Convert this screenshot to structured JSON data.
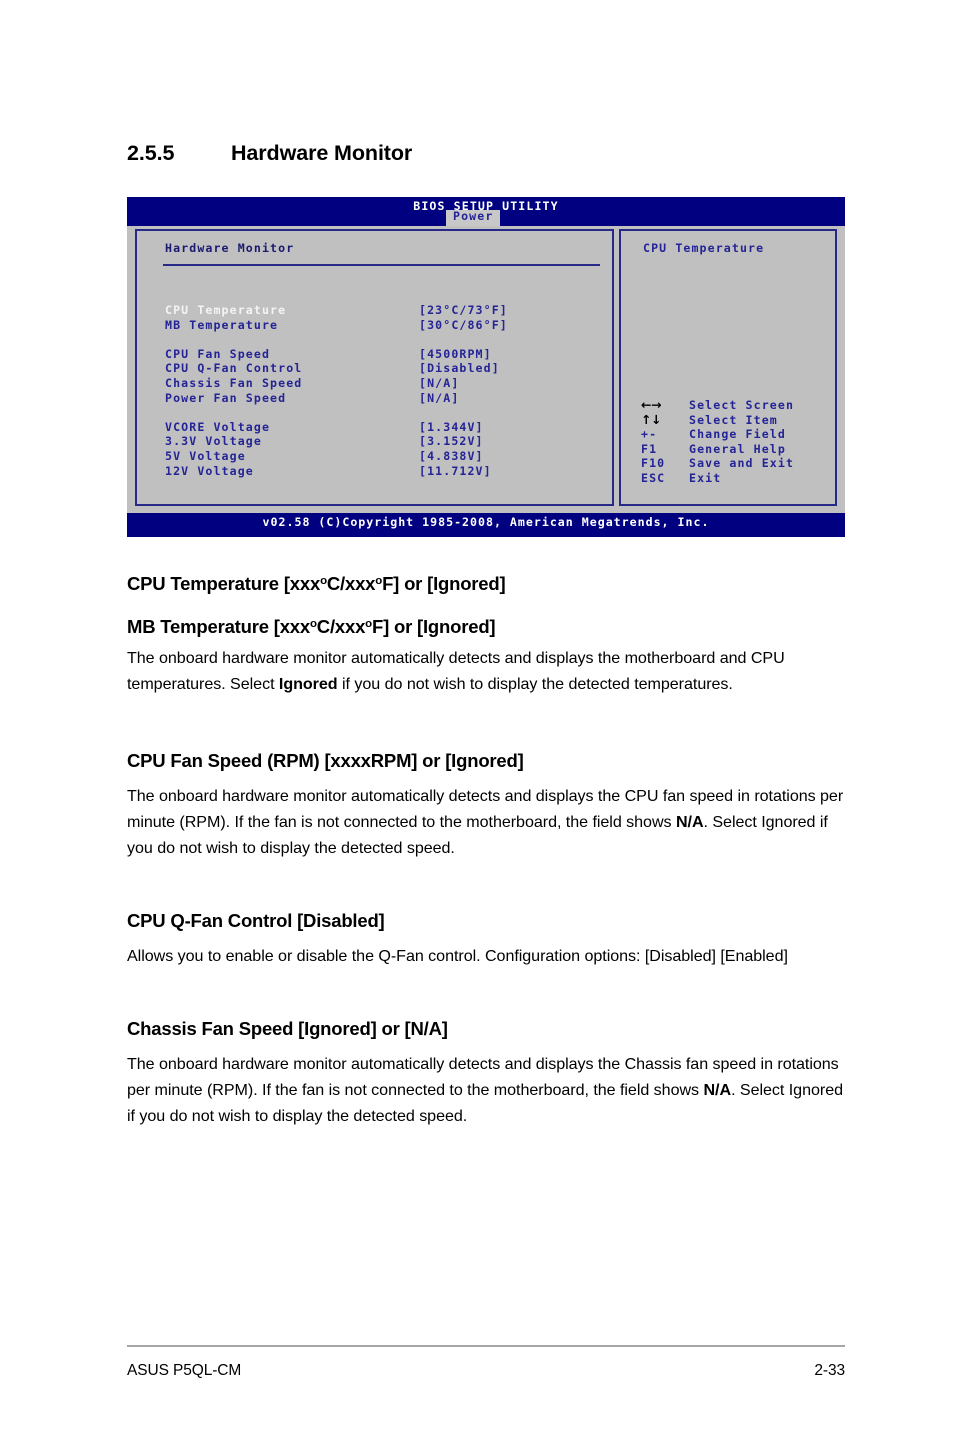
{
  "section": {
    "number": "2.5.5",
    "title": "Hardware Monitor"
  },
  "bios": {
    "title": "BIOS SETUP UTILITY",
    "active_tab": "Power",
    "panel_title": "Hardware Monitor",
    "help_title": "CPU Temperature",
    "footer": "v02.58 (C)Copyright 1985-2008, American Megatrends, Inc.",
    "rows": [
      {
        "label": "CPU Temperature",
        "value": "[23°C/73°F]",
        "selected": true,
        "gap_after": false
      },
      {
        "label": "MB Temperature",
        "value": "[30°C/86°F]",
        "selected": false,
        "gap_after": true
      },
      {
        "label": "CPU Fan Speed",
        "value": "[4500RPM]",
        "selected": false,
        "gap_after": false
      },
      {
        "label": "CPU Q-Fan Control",
        "value": "[Disabled]",
        "selected": false,
        "gap_after": false
      },
      {
        "label": "Chassis Fan Speed",
        "value": "[N/A]",
        "selected": false,
        "gap_after": false
      },
      {
        "label": "Power Fan Speed",
        "value": "[N/A]",
        "selected": false,
        "gap_after": true
      },
      {
        "label": "VCORE Voltage",
        "value": "[1.344V]",
        "selected": false,
        "gap_after": false
      },
      {
        "label": "3.3V Voltage",
        "value": "[3.152V]",
        "selected": false,
        "gap_after": false
      },
      {
        "label": "5V Voltage",
        "value": "[4.838V]",
        "selected": false,
        "gap_after": false
      },
      {
        "label": "12V Voltage",
        "value": "[11.712V]",
        "selected": false,
        "gap_after": false
      }
    ],
    "keys": [
      {
        "key": "←→",
        "glyph": true,
        "desc": "Select Screen"
      },
      {
        "key": "↑↓",
        "glyph": true,
        "desc": "Select Item"
      },
      {
        "key": "+-",
        "glyph": false,
        "desc": "Change Field"
      },
      {
        "key": "F1",
        "glyph": false,
        "desc": "General Help"
      },
      {
        "key": "F10",
        "glyph": false,
        "desc": "Save and Exit"
      },
      {
        "key": "ESC",
        "glyph": false,
        "desc": "Exit"
      }
    ]
  },
  "content": {
    "h_cpu_temp_a": "CPU Temperature [xxx",
    "h_cpu_temp_b": "C/xxx",
    "h_cpu_temp_c": "F] or [Ignored]",
    "h_mb_temp_a": "MB Temperature [xxx",
    "h_mb_temp_b": "C/xxx",
    "h_mb_temp_c": "F] or [Ignored]",
    "deg": "o",
    "p_temp_1": "The onboard hardware monitor automatically detects and displays the motherboard and CPU temperatures. Select ",
    "p_temp_bold": "Ignored",
    "p_temp_2": " if you do not wish to display the detected temperatures.",
    "h_cpu_fan": "CPU Fan Speed (RPM) [xxxxRPM] or [Ignored]",
    "p_cpu_fan_1": "The onboard hardware monitor automatically detects and displays the CPU fan speed in rotations per minute (RPM). If the fan is not connected to the motherboard, the field shows ",
    "p_cpu_fan_bold": "N/A",
    "p_cpu_fan_2": ". Select Ignored if you do not wish to display the detected speed.",
    "h_qfan": "CPU Q-Fan Control [Disabled]",
    "p_qfan": "Allows you to enable or disable the Q-Fan control. Configuration options: [Disabled] [Enabled]",
    "h_chassis": "Chassis Fan Speed [Ignored] or [N/A]",
    "p_chassis_1": "The onboard hardware monitor automatically detects and displays the Chassis fan speed in rotations per minute (RPM). If the fan is not connected to the motherboard, the field shows ",
    "p_chassis_bold": "N/A",
    "p_chassis_2": ". Select Ignored if you do not wish to display the detected speed."
  },
  "footer": {
    "left": "ASUS P5QL-CM",
    "right": "2-33"
  }
}
